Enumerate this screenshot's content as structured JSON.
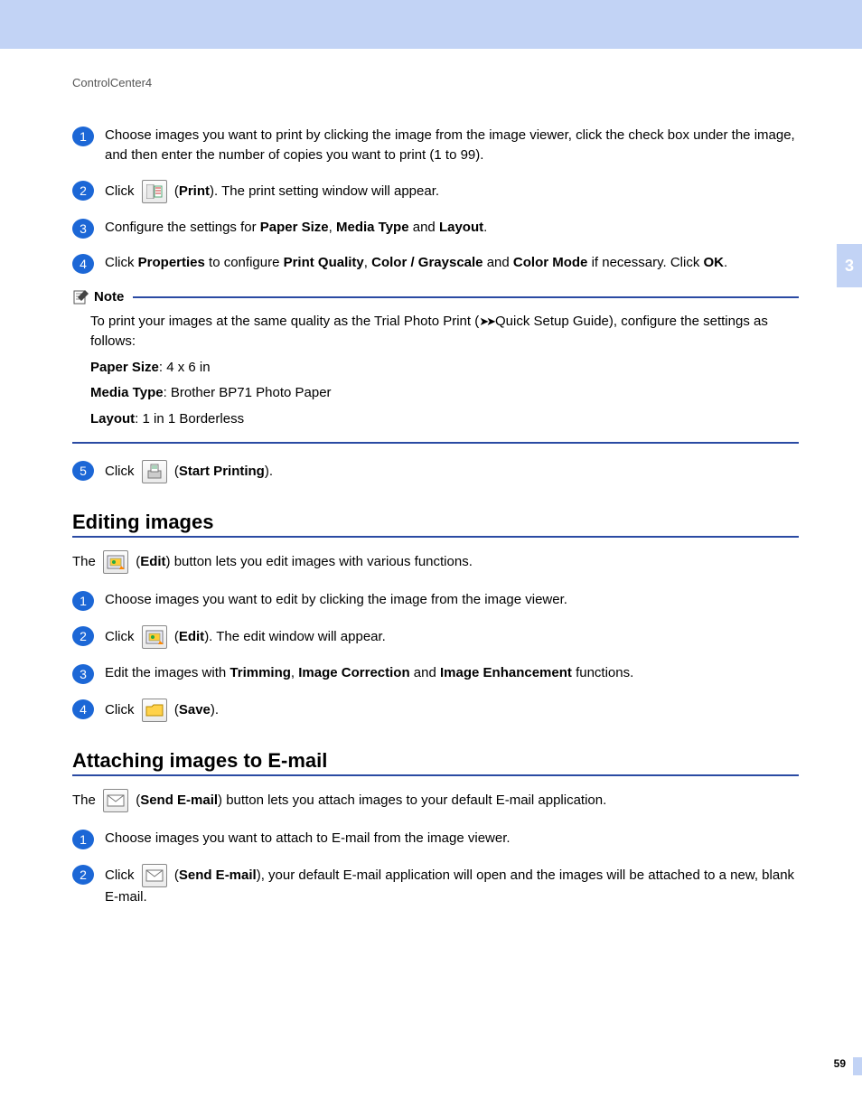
{
  "header": "ControlCenter4",
  "sideTabLabel": "3",
  "pageNumber": "59",
  "stepsA": {
    "s1": "Choose images you want to print by clicking the image from the image viewer, click the check box under the image, and then enter the number of copies you want to print (1 to 99).",
    "s2a": "Click ",
    "s2b": " (",
    "s2c": "Print",
    "s2d": "). The print setting window will appear.",
    "s3a": "Configure the settings for ",
    "s3b": "Paper Size",
    "s3c": ", ",
    "s3d": "Media Type",
    "s3e": " and ",
    "s3f": "Layout",
    "s3g": ".",
    "s4a": "Click ",
    "s4b": "Properties",
    "s4c": " to configure ",
    "s4d": "Print Quality",
    "s4e": ", ",
    "s4f": "Color / Grayscale",
    "s4g": " and ",
    "s4h": "Color Mode",
    "s4i": " if necessary. Click ",
    "s4j": "OK",
    "s4k": "."
  },
  "note": {
    "title": "Note",
    "line1a": "To print your images at the same quality as the Trial Photo Print (",
    "line1b": "Quick Setup Guide), configure the settings as follows:",
    "paperLabel": "Paper Size",
    "paperValue": ": 4 x 6 in",
    "mediaLabel": "Media Type",
    "mediaValue": ": Brother BP71 Photo Paper",
    "layoutLabel": "Layout",
    "layoutValue": ": 1 in 1 Borderless"
  },
  "step5": {
    "a": "Click ",
    "b": " (",
    "c": "Start Printing",
    "d": ")."
  },
  "sectionEditing": {
    "title": "Editing images",
    "intro_a": "The ",
    "intro_b": " (",
    "intro_c": "Edit",
    "intro_d": ") button lets you edit images with various functions.",
    "s1": "Choose images you want to edit by clicking the image from the image viewer.",
    "s2a": "Click ",
    "s2b": " (",
    "s2c": "Edit",
    "s2d": "). The edit window will appear.",
    "s3a": "Edit the images with ",
    "s3b": "Trimming",
    "s3c": ", ",
    "s3d": "Image Correction",
    "s3e": " and ",
    "s3f": "Image Enhancement",
    "s3g": " functions.",
    "s4a": "Click ",
    "s4b": " (",
    "s4c": "Save",
    "s4d": ")."
  },
  "sectionEmail": {
    "title": "Attaching images to E-mail",
    "intro_a": "The ",
    "intro_b": " (",
    "intro_c": "Send E-mail",
    "intro_d": ") button lets you attach images to your default E-mail application.",
    "s1": "Choose images you want to attach to E-mail from the image viewer.",
    "s2a": "Click ",
    "s2b": " (",
    "s2c": "Send E-mail",
    "s2d": "), your default E-mail application will open and the images will be attached to a new, blank E-mail."
  }
}
